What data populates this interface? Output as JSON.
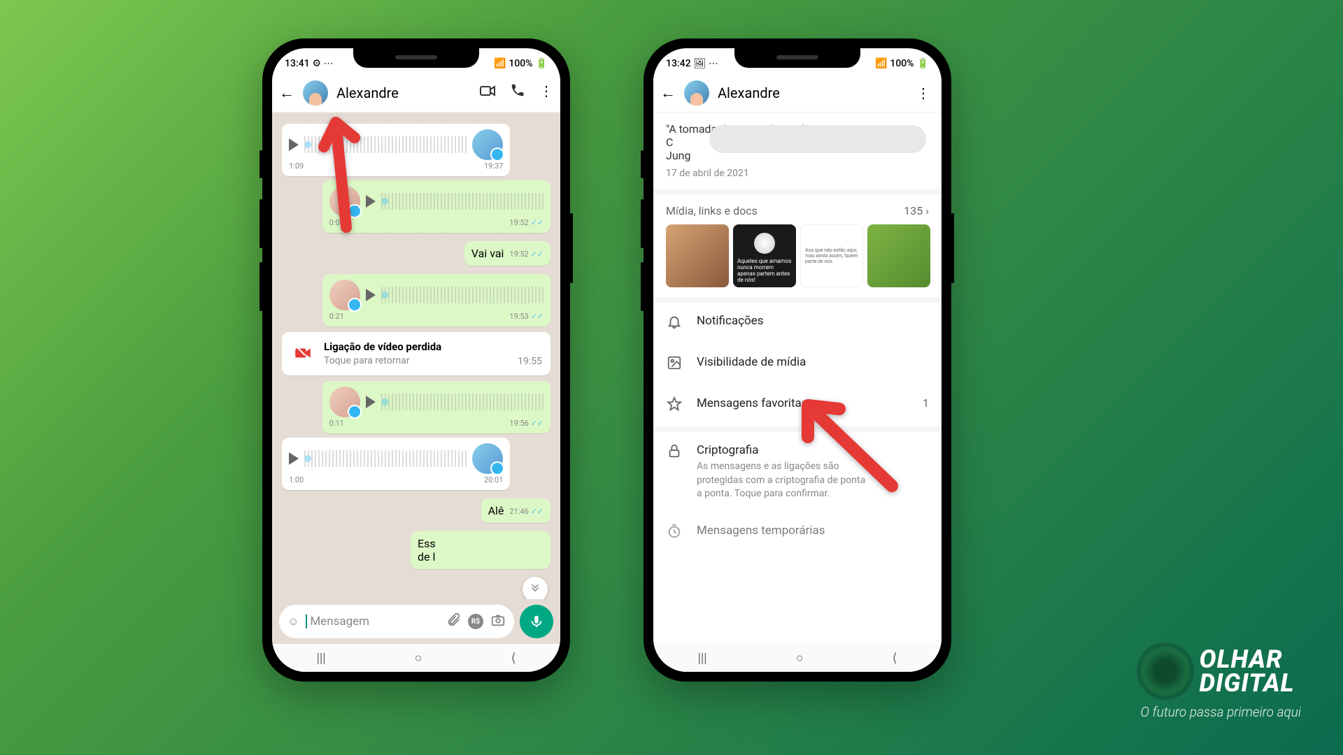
{
  "status": {
    "time_left": "13:41",
    "time_right": "13:42",
    "battery": "100%"
  },
  "chat": {
    "contact_name": "Alexandre",
    "messages": [
      {
        "type": "voice_in",
        "duration": "1:09",
        "time": "19:37"
      },
      {
        "type": "voice_out",
        "duration": "0:08",
        "time": "19:52"
      },
      {
        "type": "text_out",
        "text": "Vai vai",
        "time": "19:52"
      },
      {
        "type": "voice_out",
        "duration": "0:21",
        "time": "19:53"
      },
      {
        "type": "missed_call",
        "title": "Ligação de vídeo perdida",
        "subtitle": "Toque para retornar",
        "time": "19:55"
      },
      {
        "type": "voice_out",
        "duration": "0:11",
        "time": "19:56"
      },
      {
        "type": "voice_in",
        "duration": "1:00",
        "time": "20:01"
      },
      {
        "type": "text_out",
        "text": "Alê",
        "time": "21:46"
      },
      {
        "type": "text_out_partial",
        "text": "Ess",
        "text2": "de l"
      }
    ],
    "input_placeholder": "Mensagem"
  },
  "info": {
    "contact_name": "Alexandre",
    "quote_line1": "\"A tomada da Consciência é um",
    "quote_line2": "C",
    "quote_line3": "Jung",
    "date": "17 de abril de 2021",
    "media_label": "Mídia, links e docs",
    "media_count": "135",
    "thumb2_text": "Aqueles que amamos nunca morrem apenas partem antes de nós!",
    "thumb3_text": "Aos que não estão aqui, mas ainda assim, fazem parte de nós.",
    "settings": [
      {
        "icon": "bell",
        "label": "Notificações"
      },
      {
        "icon": "image",
        "label": "Visibilidade de mídia"
      },
      {
        "icon": "star",
        "label": "Mensagens favoritas",
        "count": "1"
      }
    ],
    "crypto_title": "Criptografia",
    "crypto_desc": "As mensagens e as ligações são protegidas com a criptografia de ponta a ponta. Toque para confirmar.",
    "temp_msg": "Mensagens temporárias"
  },
  "brand": {
    "line1": "OLHAR",
    "line2": "DIGITAL",
    "slogan": "O futuro passa primeiro aqui"
  }
}
